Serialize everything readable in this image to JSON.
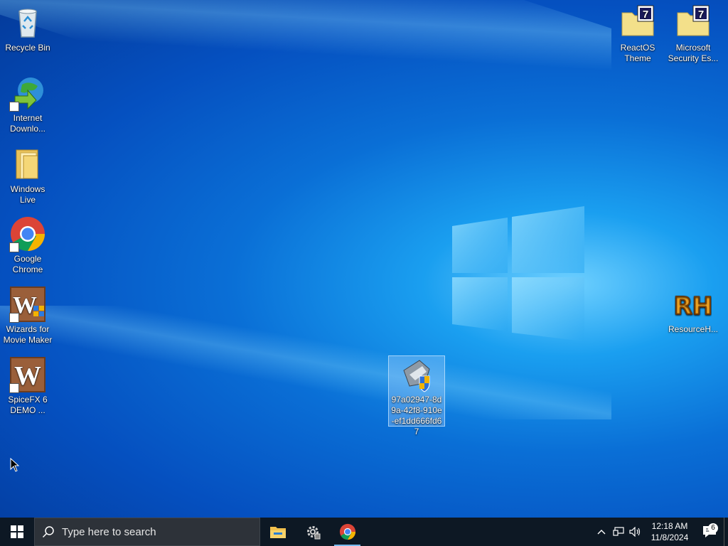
{
  "desktop": {
    "icons": [
      {
        "label": "Recycle Bin"
      },
      {
        "label": "Internet Downlo..."
      },
      {
        "label": "Windows Live"
      },
      {
        "label": "Google Chrome"
      },
      {
        "label": "Wizards for Movie Maker"
      },
      {
        "label": "SpiceFX 6 DEMO ..."
      },
      {
        "label": "ReactOS Theme"
      },
      {
        "label": "Microsoft Security Es..."
      },
      {
        "label": "ResourceH..."
      },
      {
        "label": "97a02947-8d9a-42f8-910e-ef1dd666fd67"
      }
    ]
  },
  "taskbar": {
    "search_placeholder": "Type here to search",
    "clock_time": "12:18 AM",
    "clock_date": "11/8/2024",
    "notification_count": "6"
  },
  "colors": {
    "taskbar": "#0d1824",
    "search_box": "#2d3239",
    "accent": "#76b9ed"
  }
}
